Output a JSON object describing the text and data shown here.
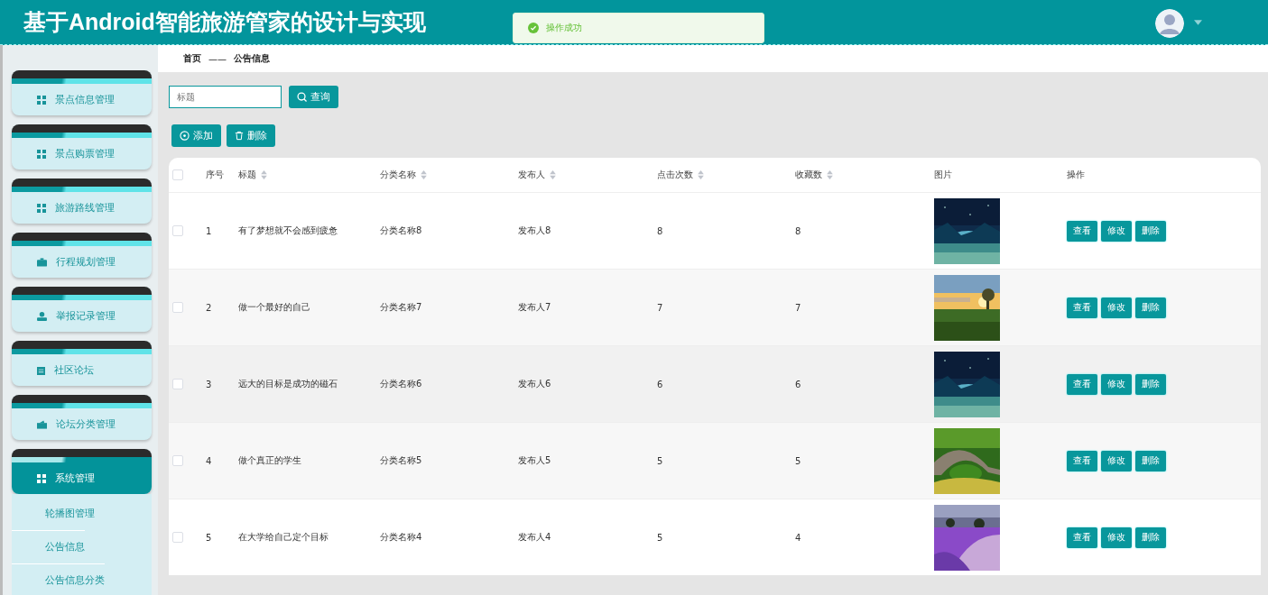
{
  "header": {
    "title": "基于Android智能旅游管家的设计与实现"
  },
  "toast": {
    "message": "操作成功"
  },
  "sidebar": {
    "items": [
      {
        "label": "景点信息管理",
        "kind": "grid",
        "selected": false
      },
      {
        "label": "景点购票管理",
        "kind": "grid",
        "selected": false
      },
      {
        "label": "旅游路线管理",
        "kind": "grid",
        "selected": false
      },
      {
        "label": "行程规划管理",
        "kind": "briefcase",
        "selected": false
      },
      {
        "label": "举报记录管理",
        "kind": "person",
        "selected": false
      },
      {
        "label": "社区论坛",
        "kind": "clipboard",
        "selected": false
      },
      {
        "label": "论坛分类管理",
        "kind": "wallet",
        "selected": false
      },
      {
        "label": "系统管理",
        "kind": "grid",
        "selected": true,
        "expanded": true,
        "children": [
          {
            "label": "轮播图管理"
          },
          {
            "label": "公告信息"
          },
          {
            "label": "公告信息分类"
          }
        ]
      }
    ]
  },
  "breadcrumb": [
    "首页",
    "公告信息"
  ],
  "breadcrumb_separator": "——",
  "search": {
    "placeholder": "标题",
    "button": "查询"
  },
  "actions": [
    "添加",
    "删除"
  ],
  "table": {
    "all_checked": false,
    "columns": [
      {
        "label": "序号",
        "sortable": false
      },
      {
        "label": "标题",
        "sortable": true
      },
      {
        "label": "分类名称",
        "sortable": true
      },
      {
        "label": "发布人",
        "sortable": true
      },
      {
        "label": "点击次数",
        "sortable": true
      },
      {
        "label": "收藏数",
        "sortable": true
      },
      {
        "label": "图片",
        "sortable": false
      },
      {
        "label": "操作",
        "sortable": false
      }
    ],
    "rows": [
      {
        "checked": false,
        "cells": [
          "1",
          "有了梦想就不会感到疲惫",
          "分类名称8",
          "发布人8",
          "8",
          "8"
        ],
        "buttons": [
          "查看",
          "修改",
          "删除"
        ]
      },
      {
        "checked": false,
        "cells": [
          "2",
          "做一个最好的自己",
          "分类名称7",
          "发布人7",
          "7",
          "7"
        ],
        "buttons": [
          "查看",
          "修改",
          "删除"
        ]
      },
      {
        "checked": false,
        "cells": [
          "3",
          "远大的目标是成功的磁石",
          "分类名称6",
          "发布人6",
          "6",
          "6"
        ],
        "buttons": [
          "查看",
          "修改",
          "删除"
        ]
      },
      {
        "checked": false,
        "cells": [
          "4",
          "做个真正的学生",
          "分类名称5",
          "发布人5",
          "5",
          "5"
        ],
        "buttons": [
          "查看",
          "修改",
          "删除"
        ]
      },
      {
        "checked": false,
        "cells": [
          "5",
          "在大学给自己定个目标",
          "分类名称4",
          "发布人4",
          "5",
          "4"
        ],
        "buttons": [
          "查看",
          "修改",
          "删除"
        ]
      }
    ]
  }
}
